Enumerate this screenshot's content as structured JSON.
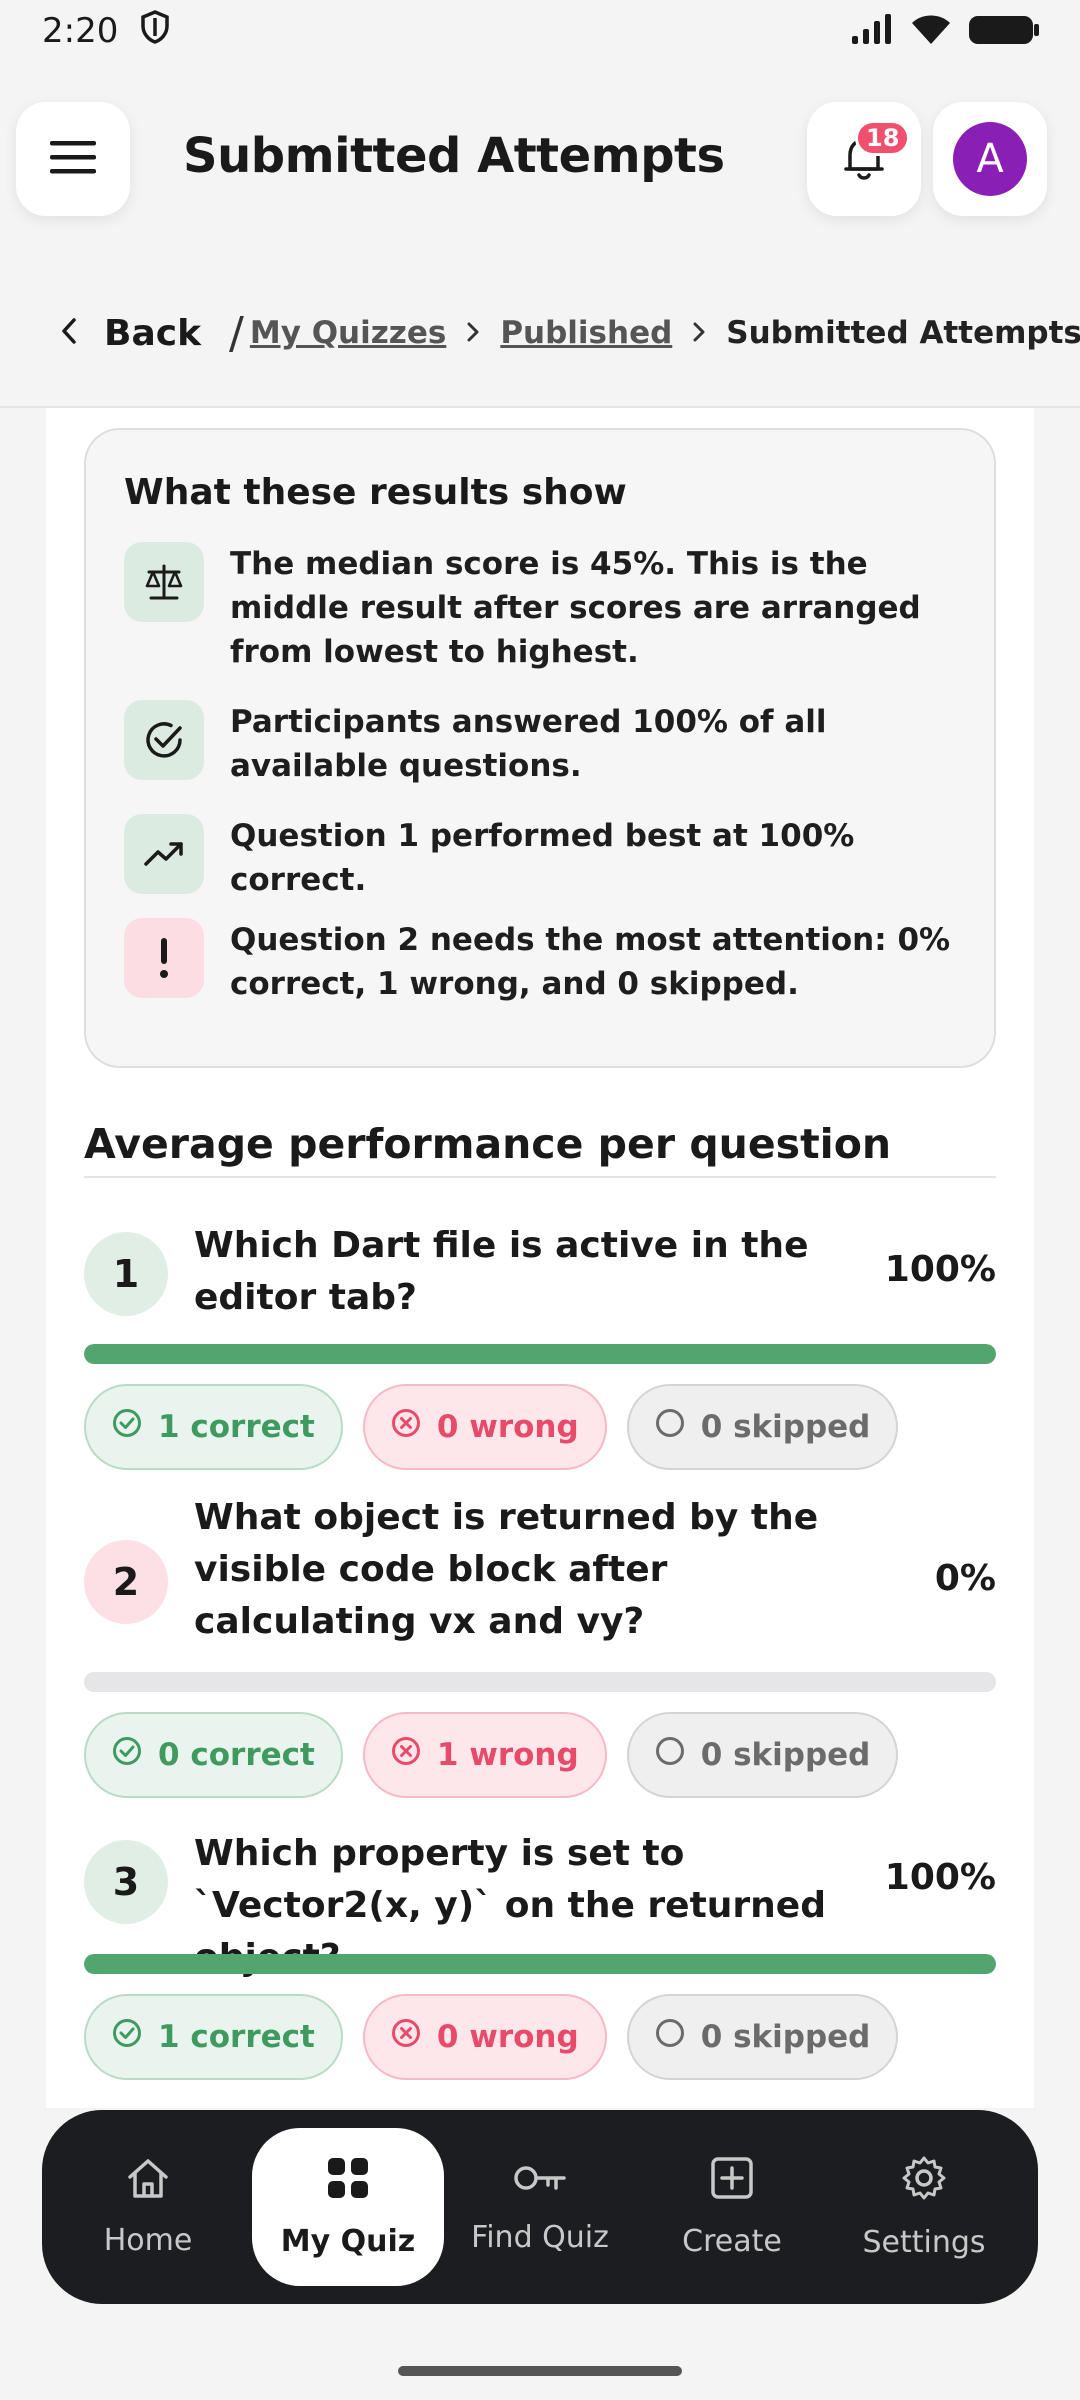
{
  "status_bar": {
    "time": "2:20"
  },
  "header": {
    "title": "Submitted Attempts",
    "notification_count": "18",
    "avatar_initial": "A"
  },
  "breadcrumb": {
    "back_label": "Back",
    "separator": "/",
    "items": [
      "My Quizzes",
      "Published",
      "Submitted Attempts"
    ]
  },
  "results": {
    "title": "What these results show",
    "insights": [
      {
        "icon": "scale-icon",
        "text": "The median score is 45%. This is the middle result after scores are arranged from lowest to highest."
      },
      {
        "icon": "check-circle-icon",
        "text": "Participants answered 100% of all available questions."
      },
      {
        "icon": "trending-up-icon",
        "text": "Question 1 performed best at 100% correct."
      },
      {
        "icon": "exclamation-icon",
        "text": "Question 2 needs the most attention: 0% correct, 1 wrong, and 0 skipped."
      }
    ]
  },
  "performance": {
    "title": "Average performance per question",
    "questions": [
      {
        "number": "1",
        "text": "Which Dart file is active in the editor tab?",
        "percent_label": "100%",
        "progress": 1.0,
        "correct": "1 correct",
        "wrong": "0 wrong",
        "skipped": "0 skipped"
      },
      {
        "number": "2",
        "text": "What object is returned by the visible code block after calculating vx and vy?",
        "percent_label": "0%",
        "progress": 0.0,
        "correct": "0 correct",
        "wrong": "1 wrong",
        "skipped": "0 skipped"
      },
      {
        "number": "3",
        "text": "Which property is set to `Vector2(x, y)` on the returned object?",
        "percent_label": "100%",
        "progress": 1.0,
        "correct": "1 correct",
        "wrong": "0 wrong",
        "skipped": "0 skipped"
      }
    ]
  },
  "bottom_nav": {
    "items": [
      {
        "label": "Home",
        "icon": "home-icon"
      },
      {
        "label": "My Quiz",
        "icon": "grid-icon"
      },
      {
        "label": "Find Quiz",
        "icon": "key-icon"
      },
      {
        "label": "Create",
        "icon": "plus-square-icon"
      },
      {
        "label": "Settings",
        "icon": "gear-icon"
      }
    ],
    "active": "My Quiz"
  },
  "colors": {
    "success": "#52a56e",
    "danger": "#e84a6a",
    "avatar": "#8a1fb5",
    "nav_bg": "#1c1d20"
  }
}
